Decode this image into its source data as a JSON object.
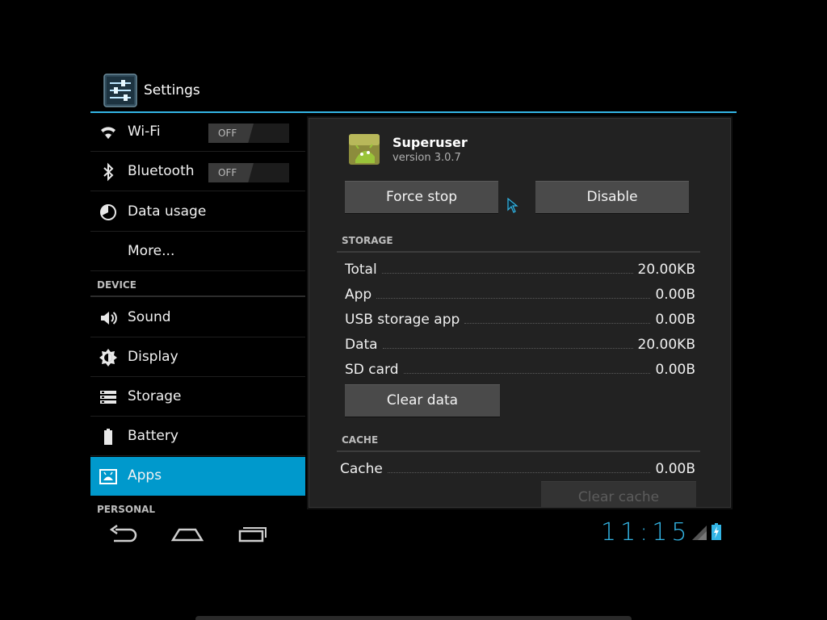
{
  "action_bar": {
    "title": "Settings",
    "icon": "settings-sliders-icon"
  },
  "sidebar": {
    "items": [
      {
        "id": "wifi",
        "label": "Wi-Fi",
        "icon": "wifi-icon",
        "toggle": "OFF"
      },
      {
        "id": "bluetooth",
        "label": "Bluetooth",
        "icon": "bluetooth-icon",
        "toggle": "OFF"
      },
      {
        "id": "data-usage",
        "label": "Data usage",
        "icon": "data-usage-icon"
      },
      {
        "id": "more",
        "label": "More..."
      }
    ],
    "device_header": "DEVICE",
    "device_items": [
      {
        "id": "sound",
        "label": "Sound",
        "icon": "speaker-icon"
      },
      {
        "id": "display",
        "label": "Display",
        "icon": "brightness-icon"
      },
      {
        "id": "storage",
        "label": "Storage",
        "icon": "storage-icon"
      },
      {
        "id": "battery",
        "label": "Battery",
        "icon": "battery-icon"
      },
      {
        "id": "apps",
        "label": "Apps",
        "icon": "apps-icon",
        "selected": true
      }
    ],
    "personal_header": "PERSONAL"
  },
  "app_info": {
    "name": "Superuser",
    "version": "version 3.0.7",
    "icon": "android-superuser-icon",
    "force_stop_label": "Force stop",
    "disable_label": "Disable",
    "storage_header": "STORAGE",
    "storage": [
      {
        "label": "Total",
        "value": "20.00KB"
      },
      {
        "label": "App",
        "value": "0.00B"
      },
      {
        "label": "USB storage app",
        "value": "0.00B"
      },
      {
        "label": "Data",
        "value": "20.00KB"
      },
      {
        "label": "SD card",
        "value": "0.00B"
      }
    ],
    "clear_data_label": "Clear data",
    "cache_header": "CACHE",
    "cache": {
      "label": "Cache",
      "value": "0.00B"
    },
    "clear_cache_label": "Clear cache"
  },
  "system_bar": {
    "clock": "11:15",
    "nav": [
      "back-icon",
      "home-icon",
      "recent-apps-icon"
    ],
    "status_icons": [
      "signal-icon",
      "battery-charging-icon"
    ]
  },
  "colors": {
    "accent": "#33b5e5",
    "selected": "#0099cc",
    "panel": "#222222"
  }
}
